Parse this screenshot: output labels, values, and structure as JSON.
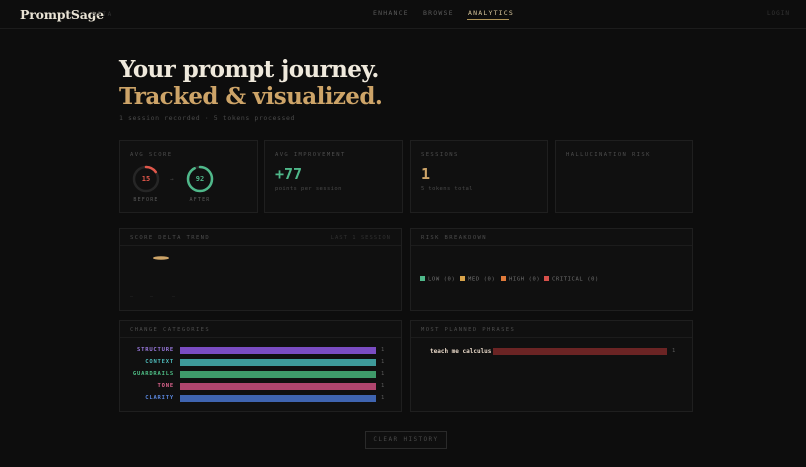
{
  "app": {
    "brand": "PromptSage",
    "brand_tag": "BETA",
    "nav": [
      {
        "label": "ENHANCE"
      },
      {
        "label": "BROWSE"
      },
      {
        "label": "ANALYTICS",
        "active": true
      }
    ],
    "top_right": "LOGIN"
  },
  "hero": {
    "line1": "Your prompt journey.",
    "line2": "Tracked & visualized.",
    "subtitle": "1 session recorded · 5 tokens processed"
  },
  "stats": {
    "avg_score": {
      "label": "AVG SCORE",
      "before": {
        "value": "15",
        "caption": "BEFORE",
        "fraction": 0.15,
        "color": "#e0574a"
      },
      "after": {
        "value": "92",
        "caption": "AFTER",
        "fraction": 0.92,
        "color": "#4fb88a"
      },
      "arrow": "→"
    },
    "avg_improvement": {
      "label": "AVG IMPROVEMENT",
      "value": "+77",
      "sub": "points per session",
      "color": "#4fb88a"
    },
    "sessions": {
      "label": "SESSIONS",
      "value": "1",
      "sub": "5 tokens total",
      "color": "#cda468"
    },
    "hallucination": {
      "label": "HALLUCINATION RISK"
    }
  },
  "score_delta": {
    "label": "SCORE DELTA TREND",
    "right_label": "LAST 1 SESSION",
    "x_ticks": [
      "—",
      "—",
      "—"
    ]
  },
  "risk": {
    "label": "RISK BREAKDOWN",
    "legend": [
      {
        "label": "LOW (0)",
        "color": "#4fb88a"
      },
      {
        "label": "MED (0)",
        "color": "#d8a34a"
      },
      {
        "label": "HIGH (0)",
        "color": "#e07a3a"
      },
      {
        "label": "CRITICAL (0)",
        "color": "#d6504a"
      }
    ]
  },
  "categories": {
    "label": "CHANGE CATEGORIES",
    "items": [
      {
        "name": "STRUCTURE",
        "count": "1",
        "color": "#7a4cc2",
        "text_color": "#9b7ae0"
      },
      {
        "name": "CONTEXT",
        "count": "1",
        "color": "#3e9a9a",
        "text_color": "#4fbcbc"
      },
      {
        "name": "GUARDRAILS",
        "count": "1",
        "color": "#3f9a6a",
        "text_color": "#4fbf86"
      },
      {
        "name": "TONE",
        "count": "1",
        "color": "#b0456e",
        "text_color": "#e0658f"
      },
      {
        "name": "CLARITY",
        "count": "1",
        "color": "#3f64b0",
        "text_color": "#5a86dc"
      }
    ]
  },
  "phrases": {
    "label": "MOST PLANNED PHRASES",
    "items": [
      {
        "phrase": "teach me calculus",
        "count": "1",
        "color": "#6b2424"
      }
    ]
  },
  "actions": {
    "clear": "CLEAR HISTORY"
  }
}
